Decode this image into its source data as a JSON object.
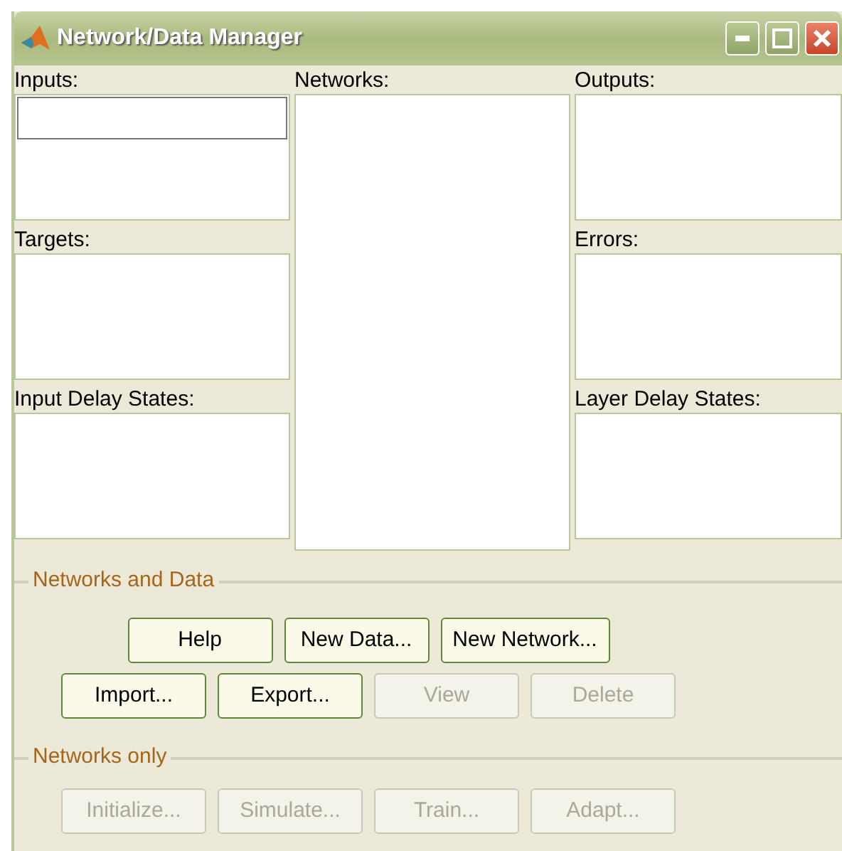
{
  "window": {
    "title": "Network/Data Manager"
  },
  "left_column": [
    {
      "label": "Inputs:"
    },
    {
      "label": "Targets:"
    },
    {
      "label": "Input Delay States:"
    }
  ],
  "middle_column": [
    {
      "label": "Networks:"
    }
  ],
  "right_column": [
    {
      "label": "Outputs:"
    },
    {
      "label": "Errors:"
    },
    {
      "label": "Layer Delay States:"
    }
  ],
  "groups": [
    {
      "title": "Networks and Data",
      "button_rows": [
        [
          {
            "label": "Help",
            "disabled": false
          },
          {
            "label": "New Data...",
            "disabled": false
          },
          {
            "label": "New Network...",
            "disabled": false
          }
        ],
        [
          {
            "label": "Import...",
            "disabled": false
          },
          {
            "label": "Export...",
            "disabled": false
          },
          {
            "label": "View",
            "disabled": true
          },
          {
            "label": "Delete",
            "disabled": true
          }
        ]
      ]
    },
    {
      "title": "Networks only",
      "button_rows": [
        [
          {
            "label": "Initialize...",
            "disabled": true
          },
          {
            "label": "Simulate...",
            "disabled": true
          },
          {
            "label": "Train...",
            "disabled": true
          },
          {
            "label": "Adapt...",
            "disabled": true
          }
        ]
      ]
    }
  ]
}
